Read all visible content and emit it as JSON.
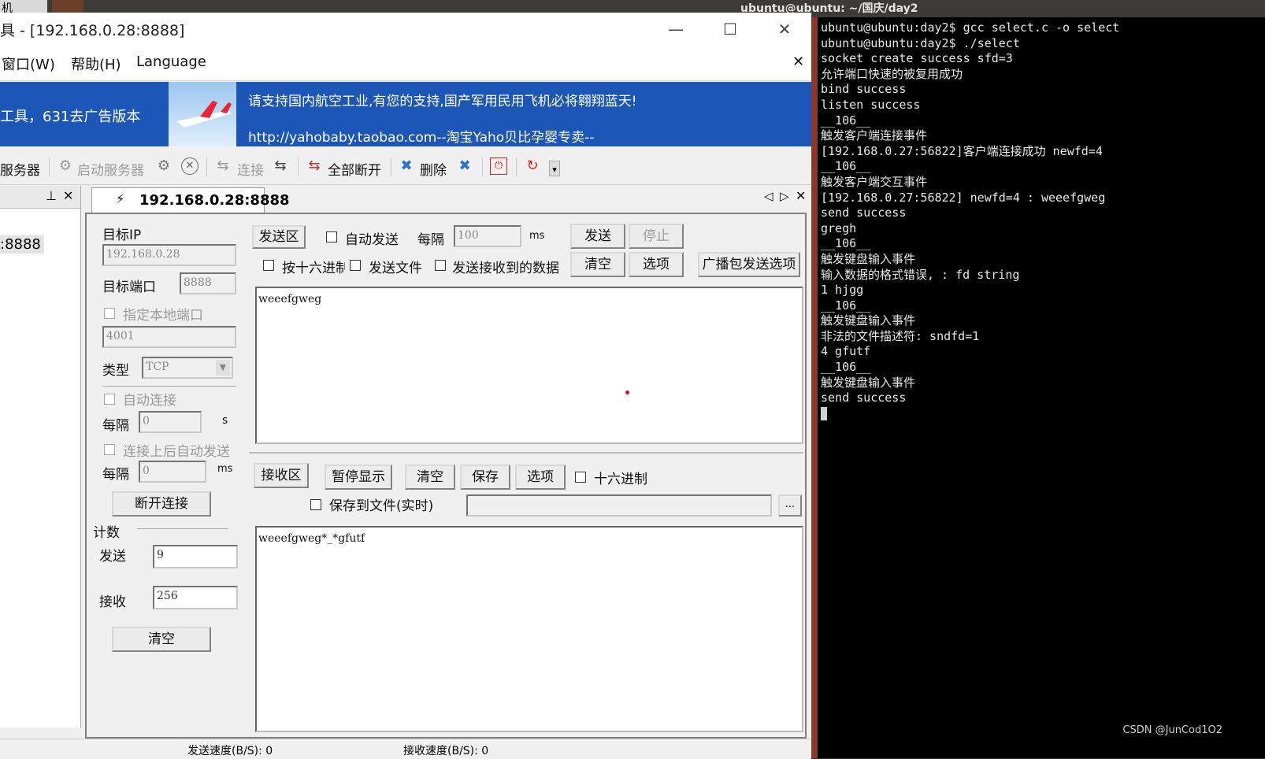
{
  "top": {
    "left_tab": "机",
    "terminal_title": "ubuntu@ubuntu: ~/国庆/day2"
  },
  "window": {
    "title": "具 - [192.168.0.28:8888]",
    "controls": {
      "minimize": "—",
      "maximize": "☐",
      "close": "✕"
    }
  },
  "menu": {
    "window": "窗口(W)",
    "help": "帮助(H)",
    "language": "Language",
    "close": "✕"
  },
  "banner": {
    "left_text": "工具，631去广告版本",
    "line1": "请支持国内航空工业,有您的支持,国产军用民用飞机必将翱翔蓝天!",
    "line2": "http://yahobaby.taobao.com--淘宝Yaho贝比孕婴专卖--"
  },
  "toolbar": {
    "server": "服务器",
    "start_server": "启动服务器",
    "connect": "连接",
    "disconnect_all": "全部断开",
    "delete": "删除"
  },
  "left_panel": {
    "pin": "⊥",
    "close": "✕",
    "item": ":8888"
  },
  "doc_tab": {
    "label": "192.168.0.28:8888"
  },
  "settings": {
    "target_ip_label": "目标IP",
    "target_ip": "192.168.0.28",
    "target_port_label": "目标端口",
    "target_port": "8888",
    "local_port_label": "指定本地端口",
    "local_port": "4001",
    "type_label": "类型",
    "type_value": "TCP",
    "auto_connect_label": "自动连接",
    "interval_label": "每隔",
    "interval_value": "0",
    "interval_unit_s": "s",
    "auto_send_label": "连接上后自动发送",
    "interval2_label": "每隔",
    "interval2_value": "0",
    "interval2_unit": "ms",
    "disconnect_button": "断开连接",
    "count_label": "计数",
    "send_label": "发送",
    "send_count": "9",
    "recv_label": "接收",
    "recv_count": "256",
    "clear_button": "清空"
  },
  "send_area": {
    "label": "发送区",
    "auto_send": "自动发送",
    "interval_label": "每隔",
    "interval_value": "100",
    "interval_unit": "ms",
    "send_button": "发送",
    "stop_button": "停止",
    "hex_send": "按十六进制",
    "send_file": "发送文件",
    "send_received": "发送接收到的数据",
    "clear_button": "清空",
    "options_button": "选项",
    "broadcast_button": "广播包发送选项",
    "text": "weeefgweg"
  },
  "recv_area": {
    "label": "接收区",
    "pause_button": "暂停显示",
    "clear_button": "清空",
    "save_button": "保存",
    "options_button": "选项",
    "hex": "十六进制",
    "save_to_file": "保存到文件(实时)",
    "browse_button": "...",
    "text": "weeefgweg*_*gfutf"
  },
  "status": {
    "send_speed": "发送速度(B/S): 0",
    "recv_speed": "接收速度(B/S): 0"
  },
  "terminal": {
    "lines": [
      "ubuntu@ubuntu:day2$ gcc select.c -o select",
      "ubuntu@ubuntu:day2$ ./select",
      "socket create success sfd=3",
      "允许端口快速的被复用成功",
      "bind success",
      "listen success",
      "__106__",
      "触发客户端连接事件",
      "[192.168.0.27:56822]客户端连接成功 newfd=4",
      "__106__",
      "触发客户端交互事件",
      "[192.168.0.27:56822] newfd=4 : weeefgweg",
      "send success",
      "gregh",
      "__106__",
      "触发键盘输入事件",
      "输入数据的格式错误, : fd string",
      "1 hjgg",
      "__106__",
      "触发键盘输入事件",
      "非法的文件描述符: sndfd=1",
      "4 gfutf",
      "__106__",
      "触发键盘输入事件",
      "send success"
    ],
    "watermark": "CSDN @JunCod1O2"
  }
}
